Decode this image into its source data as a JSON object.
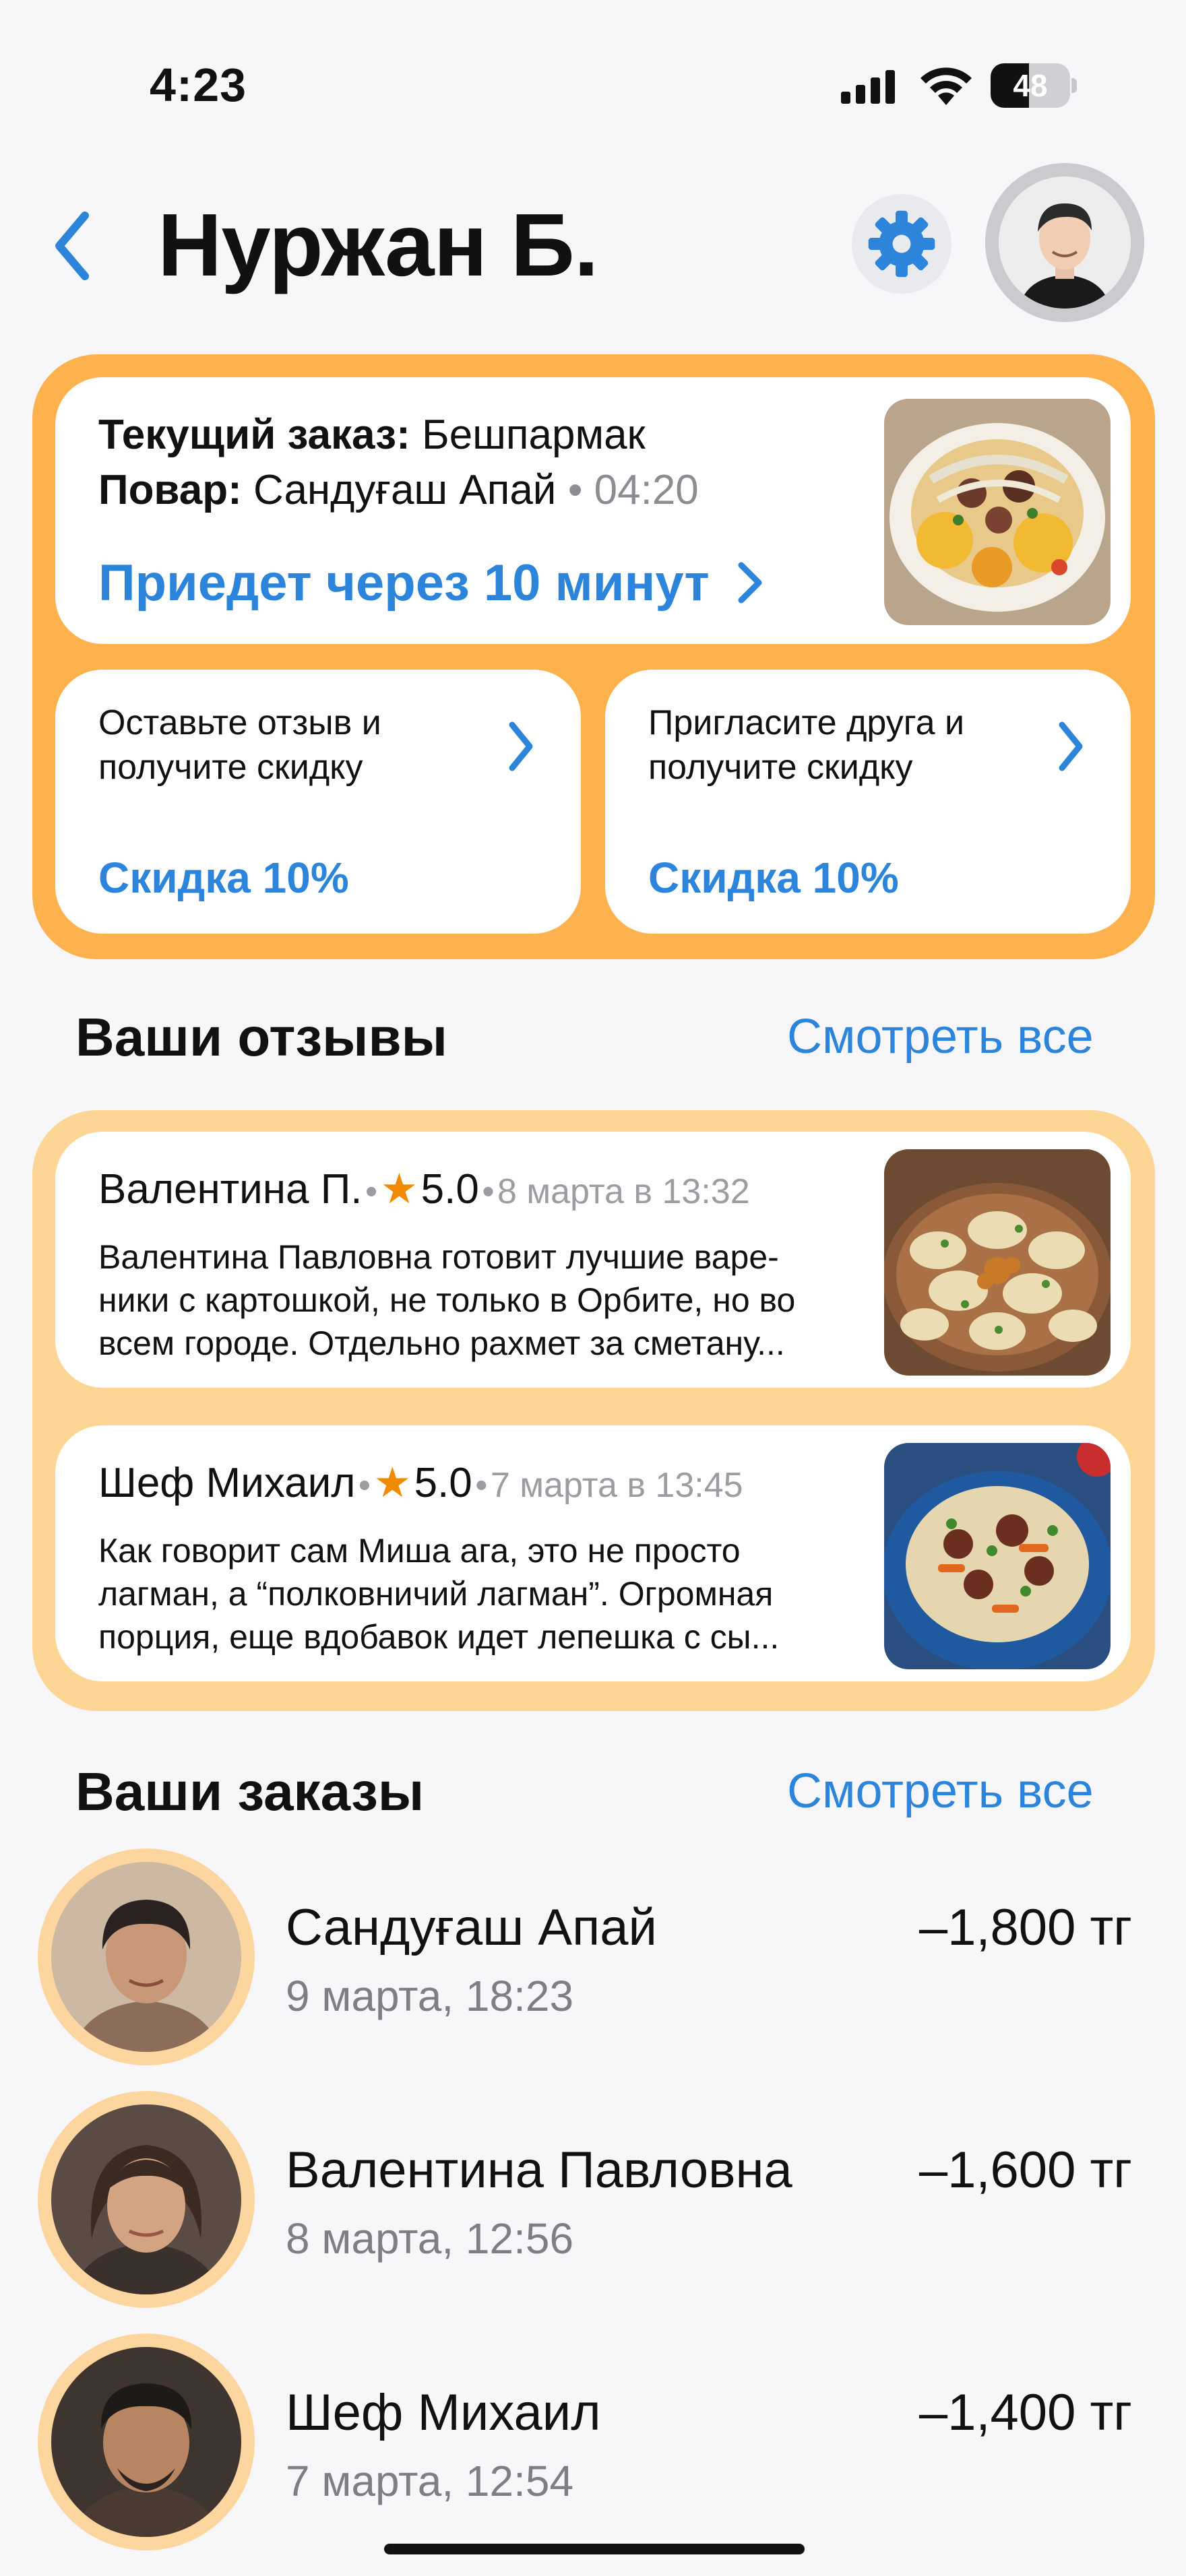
{
  "status": {
    "time": "4:23",
    "battery": "48",
    "battery_level": 0.48
  },
  "header": {
    "title": "Нуржан Б.",
    "back_icon": "chevron-left-icon",
    "settings_icon": "gear-icon"
  },
  "current_order": {
    "order_label": "Текущий заказ:",
    "order_value": "Бешпармак",
    "chef_label": "Повар:",
    "chef_value": "Сандуғаш Апай",
    "separator": "•",
    "time": "04:20",
    "link": "Приедет через 10 минут",
    "image": "beshbarmak-photo"
  },
  "promos": [
    {
      "line1": "Оставьте отзыв и",
      "line2": "получите скидку",
      "discount": "Скидка 10%"
    },
    {
      "line1": "Пригласите друга и",
      "line2": "получите скидку",
      "discount": "Скидка 10%"
    }
  ],
  "reviews_section": {
    "title": "Ваши отзывы",
    "see_all": "Смотреть все"
  },
  "reviews": [
    {
      "name": "Валентина П.",
      "sep": "•",
      "star": "★",
      "rating": "5.0",
      "sep2": "•",
      "date": "8 марта в 13:32",
      "l1": "Валентина Павловна готовит лучшие варе-",
      "l2": "ники с картошкой, не только в Орбите, но во",
      "l3": "всем городе. Отдельно рахмет за сметану...",
      "image": "vareniki-photo"
    },
    {
      "name": "Шеф Михаил",
      "sep": "•",
      "star": "★",
      "rating": "5.0",
      "sep2": "•",
      "date": "7 марта в 13:45",
      "l1": "Как говорит сам Миша ага, это не просто",
      "l2": "лагман, а “полковничий лагман”. Огромная",
      "l3": "порция, еще вдобавок идет лепешка с сы...",
      "image": "lagman-photo"
    }
  ],
  "orders_section": {
    "title": "Ваши заказы",
    "see_all": "Смотреть все"
  },
  "orders": [
    {
      "name": "Сандуғаш Апай",
      "date": "9 марта, 18:23",
      "amount": "–1,800 тг"
    },
    {
      "name": "Валентина Павловна",
      "date": "8 марта, 12:56",
      "amount": "–1,600 тг"
    },
    {
      "name": "Шеф Михаил",
      "date": "7 марта, 12:54",
      "amount": "–1,400 тг"
    }
  ],
  "colors": {
    "accent": "#2C85DA",
    "orange": "#FDB24E",
    "light_orange": "#FDD594",
    "star": "#F08A00"
  }
}
